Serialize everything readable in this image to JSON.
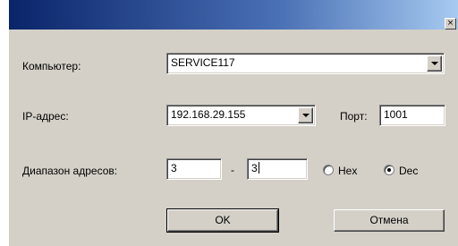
{
  "window": {
    "close_glyph": "×"
  },
  "form": {
    "computer_label": "Компьютер:",
    "computer_value": "SERVICE117",
    "ip_label": "IP-адрес:",
    "ip_value": "192.168.29.155",
    "port_label": "Порт:",
    "port_value": "1001",
    "range_label": "Диапазон адресов:",
    "range_from": "3",
    "range_separator": "-",
    "range_to": "3",
    "radio_hex_label": "Hex",
    "radio_dec_label": "Dec",
    "selected_radix": "Dec"
  },
  "buttons": {
    "ok_label": "OK",
    "cancel_label": "Отмена"
  },
  "colors": {
    "face": "#d4d0c8",
    "title_start": "#0a246a",
    "title_end": "#a6caf0"
  }
}
